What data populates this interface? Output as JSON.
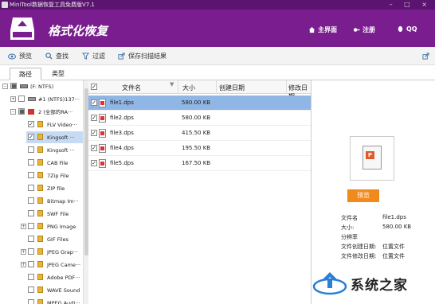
{
  "titlebar": {
    "title": "MiniTool数据恢复工具免费版V7.1",
    "controls": "– □ ×"
  },
  "header": {
    "title": "格式化恢复",
    "nav": [
      {
        "label": "主界面"
      },
      {
        "label": "注册"
      },
      {
        "label": "QQ"
      }
    ]
  },
  "toolbar": {
    "items": [
      {
        "label": "预览"
      },
      {
        "label": "查找"
      },
      {
        "label": "过滤"
      },
      {
        "label": "保存扫描结果"
      }
    ]
  },
  "tabs": [
    {
      "label": "路径"
    },
    {
      "label": "类型"
    }
  ],
  "tree": {
    "items": [
      {
        "label": "(F: NTFS)",
        "expand": "–",
        "check": "■"
      },
      {
        "label": "#1 (NTFS)137···",
        "expand": "+",
        "check": ""
      },
      {
        "label": "2 (全部的RA···",
        "expand": "–",
        "check": "■"
      },
      {
        "label": "FLV Video···",
        "expand": "",
        "check": "✓"
      },
      {
        "label": "Kingsoft ···",
        "expand": "",
        "check": "✓"
      },
      {
        "label": "Kingsoft ···",
        "expand": "",
        "check": ""
      },
      {
        "label": "CAB File",
        "expand": "",
        "check": ""
      },
      {
        "label": "7Zip File",
        "expand": "",
        "check": ""
      },
      {
        "label": "ZIP file",
        "expand": "",
        "check": ""
      },
      {
        "label": "Bitmap Im···",
        "expand": "",
        "check": ""
      },
      {
        "label": "SWF File",
        "expand": "",
        "check": ""
      },
      {
        "label": "PNG Image",
        "expand": "+",
        "check": ""
      },
      {
        "label": "GIF Files",
        "expand": "",
        "check": ""
      },
      {
        "label": "JPEG Grap···",
        "expand": "+",
        "check": ""
      },
      {
        "label": "JPEG Came···",
        "expand": "+",
        "check": ""
      },
      {
        "label": "Adobe PDF···",
        "expand": "",
        "check": ""
      },
      {
        "label": "WAVE Sound",
        "expand": "",
        "check": ""
      },
      {
        "label": "MPEG Audi···",
        "expand": "",
        "check": ""
      }
    ]
  },
  "list": {
    "columns": {
      "name": "文件名",
      "size": "大小",
      "created": "创建日期",
      "modified": "修改日期"
    },
    "rows": [
      {
        "name": "file1.dps",
        "size": "580.00 KB"
      },
      {
        "name": "file2.dps",
        "size": "580.00 KB"
      },
      {
        "name": "file3.dps",
        "size": "415.50 KB"
      },
      {
        "name": "file4.dps",
        "size": "195.50 KB"
      },
      {
        "name": "file5.dps",
        "size": "167.50 KB"
      }
    ]
  },
  "preview": {
    "button": "预览",
    "info": [
      {
        "key": "文件名",
        "value": "file1.dps"
      },
      {
        "key": "大小:",
        "value": "580.00 KB"
      },
      {
        "key": "分辨率",
        "value": ""
      },
      {
        "key": "文件创建日期:",
        "value": "位置文件"
      },
      {
        "key": "文件修改日期:",
        "value": "位置文件"
      }
    ]
  },
  "watermark": {
    "text": "系统之家"
  },
  "colors": {
    "header": "#7a1e8f",
    "titlebar": "#5b1470",
    "selection": "#8fb6e5",
    "button": "#f08a1c"
  }
}
